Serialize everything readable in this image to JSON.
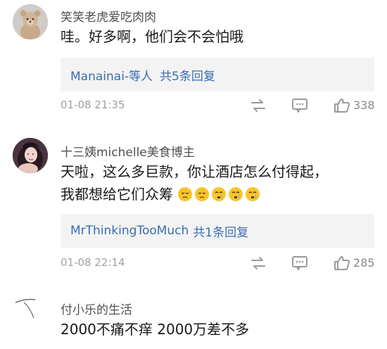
{
  "colors": {
    "link": "#3b6db3",
    "meta": "#a0a0a0",
    "reply_bg": "#f3f3f3"
  },
  "comments": [
    {
      "username": "笑笑老虎爱吃肉肉",
      "text_lines": [
        "哇。好多啊，他们会不会怕哦"
      ],
      "reply_names": "Manainai-等人",
      "reply_count": "共5条回复",
      "timestamp": "01-08 21:35",
      "likes": "338",
      "avatar_icon": "teddy-bear-avatar"
    },
    {
      "username": "十三姨michelle美食博主",
      "text_lines": [
        "天啦，这么多巨款，你让酒店怎么付得起，",
        "我都想给它们众筹"
      ],
      "emojis": [
        "pensive-face",
        "pensive-face",
        "crying-face",
        "crying-face",
        "crying-face"
      ],
      "reply_names": "MrThinkingTooMuch",
      "reply_count": "共1条回复",
      "timestamp": "01-08 22:14",
      "likes": "285",
      "avatar_icon": "woman-photo-avatar"
    },
    {
      "username": "付小乐的生活",
      "text_lines": [
        "2000不痛不痒 2000万差不多"
      ],
      "avatar_icon": "sketch-avatar"
    }
  ]
}
